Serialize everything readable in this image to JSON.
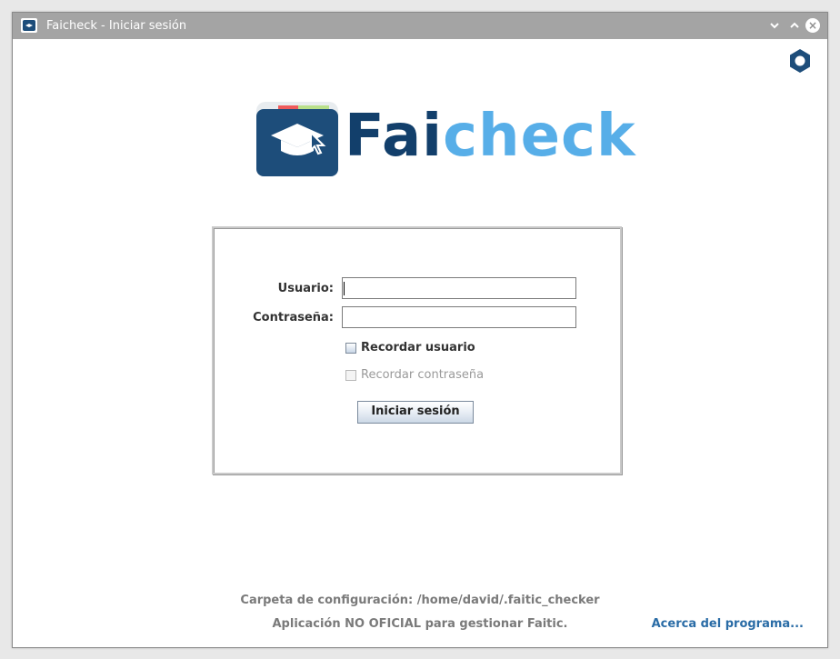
{
  "window": {
    "title": "Faicheck - Iniciar sesión",
    "minimize_glyph": "⌄",
    "maximize_glyph": "⌃",
    "close_glyph": "×"
  },
  "logo": {
    "text_part1": "Fai",
    "text_part2": "check",
    "colors": {
      "dark": "#123f6b",
      "light": "#57aee8"
    }
  },
  "login": {
    "user_label": "Usuario:",
    "user_value": "",
    "password_label": "Contraseña:",
    "password_value": "",
    "remember_user_label": "Recordar usuario",
    "remember_user_checked": false,
    "remember_password_label": "Recordar contraseña",
    "remember_password_checked": false,
    "remember_password_enabled": false,
    "submit_label": "Iniciar sesión"
  },
  "footer": {
    "config_text": "Carpeta de configuración: /home/david/.faitic_checker",
    "disclaimer": "Aplicación NO OFICIAL para gestionar Faitic.",
    "about_link": "Acerca del programa..."
  },
  "icons": {
    "settings": "hexagon-nut-icon",
    "app": "folder-graduation-cap-icon"
  }
}
